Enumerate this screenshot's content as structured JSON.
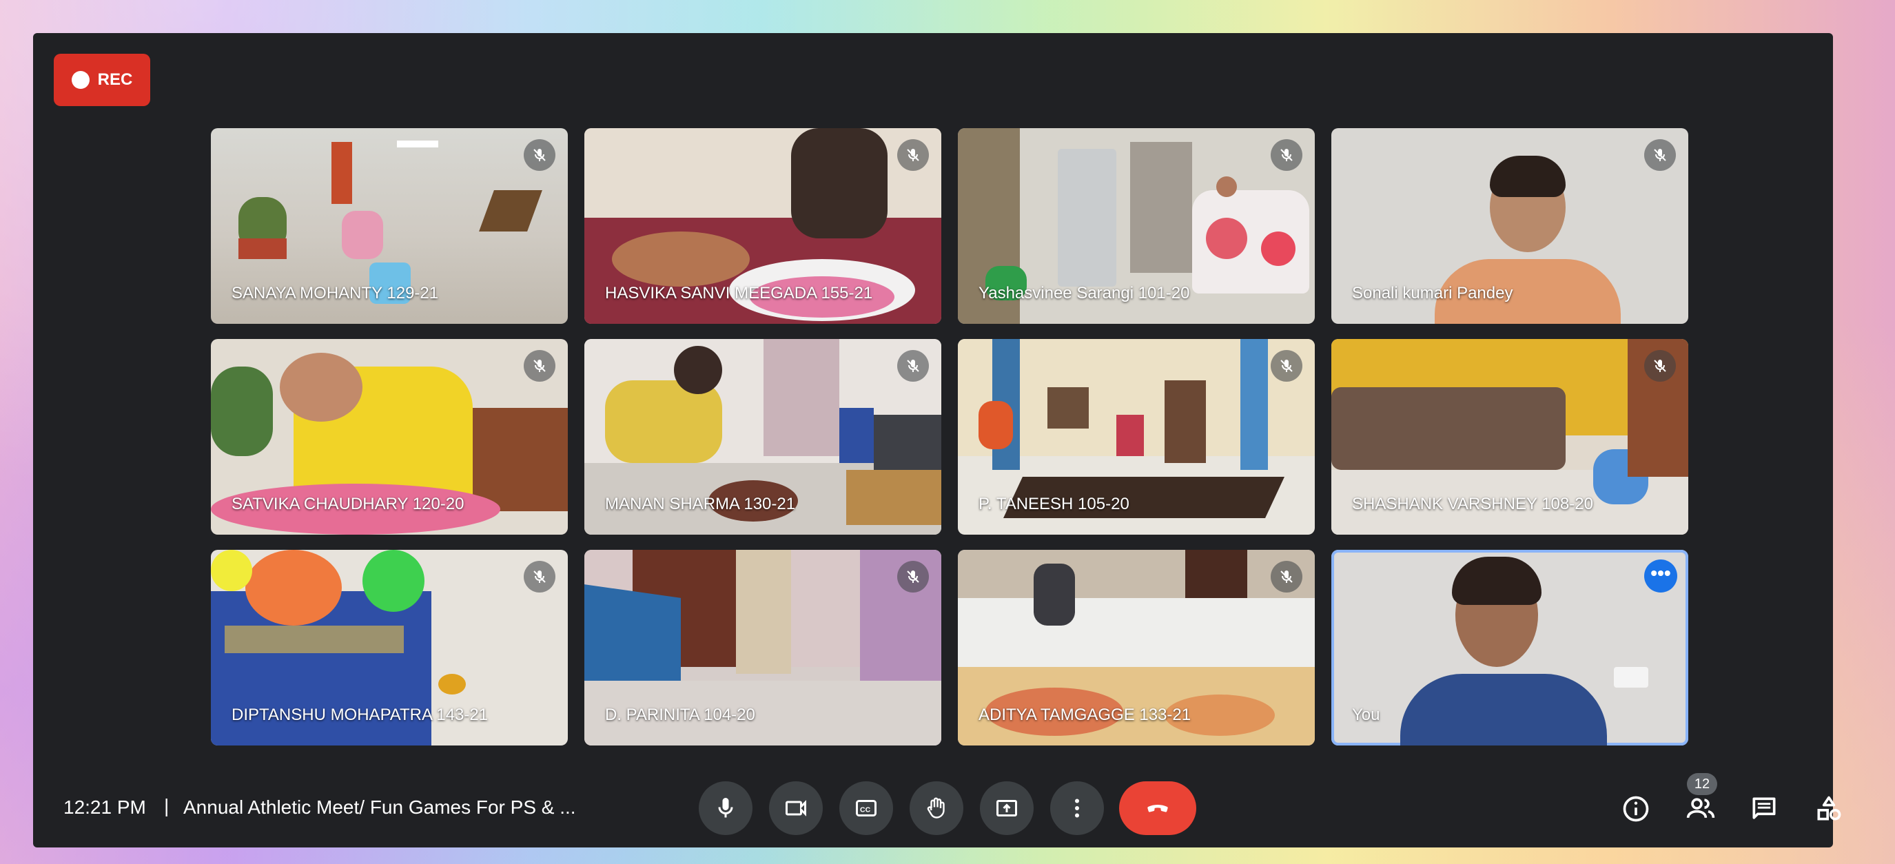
{
  "recording": {
    "label": "REC"
  },
  "participants": [
    {
      "name": "SANAYA MOHANTY 129-21",
      "muted": true
    },
    {
      "name": "HASVIKA SANVI MEEGADA 155-21",
      "muted": true
    },
    {
      "name": "Yashasvinee Sarangi 101-20",
      "muted": true
    },
    {
      "name": "Sonali kumari Pandey",
      "muted": true
    },
    {
      "name": "SATVIKA CHAUDHARY 120-20",
      "muted": true
    },
    {
      "name": "MANAN SHARMA 130-21",
      "muted": true
    },
    {
      "name": "P. TANEESH 105-20",
      "muted": true
    },
    {
      "name": "SHASHANK VARSHNEY 108-20",
      "muted": true
    },
    {
      "name": "DIPTANSHU MOHAPATRA 143-21",
      "muted": true
    },
    {
      "name": "D. PARINITA 104-20",
      "muted": true
    },
    {
      "name": "ADITYA TAMGAGGE 133-21",
      "muted": true
    },
    {
      "name": "You",
      "muted": false
    }
  ],
  "footer": {
    "time": "12:21 PM",
    "separator": "|",
    "meeting_title": "Annual Athletic Meet/ Fun Games For PS & ...",
    "participant_count": "12"
  },
  "icons": {
    "mic": "mic-icon",
    "camera": "camera-icon",
    "captions": "captions-icon",
    "hand": "raise-hand-icon",
    "present": "present-icon",
    "more": "more-vert-icon",
    "hangup": "call-end-icon",
    "info": "info-icon",
    "people": "people-icon",
    "chat": "chat-icon",
    "activities": "activities-icon"
  },
  "colors": {
    "rec": "#d93025",
    "hangup": "#ea4335",
    "background": "#202124",
    "you_outline": "#8ab4f8"
  }
}
